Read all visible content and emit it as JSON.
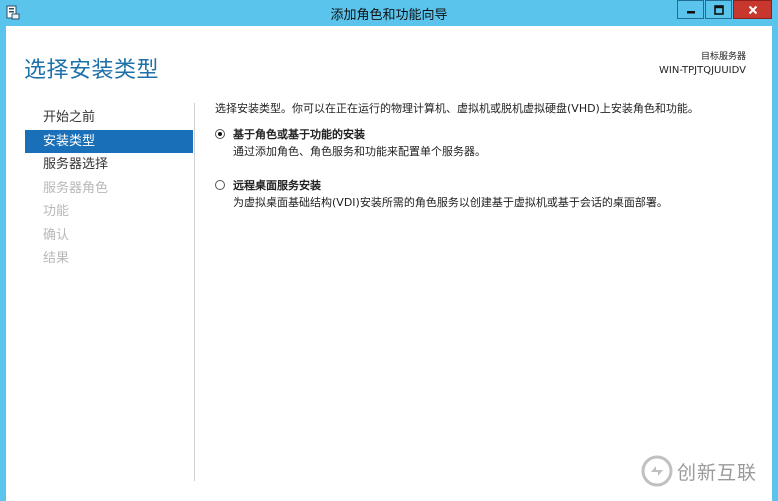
{
  "window": {
    "title": "添加角色和功能向导"
  },
  "header": {
    "page_title": "选择安装类型",
    "server_label": "目标服务器",
    "server_name": "WIN-TPJTQJUUIDV"
  },
  "nav": {
    "items": [
      {
        "label": "开始之前",
        "state": "normal"
      },
      {
        "label": "安装类型",
        "state": "active"
      },
      {
        "label": "服务器选择",
        "state": "normal"
      },
      {
        "label": "服务器角色",
        "state": "disabled"
      },
      {
        "label": "功能",
        "state": "disabled"
      },
      {
        "label": "确认",
        "state": "disabled"
      },
      {
        "label": "结果",
        "state": "disabled"
      }
    ]
  },
  "main": {
    "intro": "选择安装类型。你可以在正在运行的物理计算机、虚拟机或脱机虚拟硬盘(VHD)上安装角色和功能。",
    "options": [
      {
        "title": "基于角色或基于功能的安装",
        "description": "通过添加角色、角色服务和功能来配置单个服务器。",
        "checked": true
      },
      {
        "title": "远程桌面服务安装",
        "description": "为虚拟桌面基础结构(VDI)安装所需的角色服务以创建基于虚拟机或基于会话的桌面部署。",
        "checked": false
      }
    ]
  },
  "watermark": {
    "text": "创新互联"
  },
  "colors": {
    "titlebar": "#5ac4ed",
    "accent": "#1a70b8",
    "heading": "#1d70a8",
    "close_button": "#c7372d"
  }
}
